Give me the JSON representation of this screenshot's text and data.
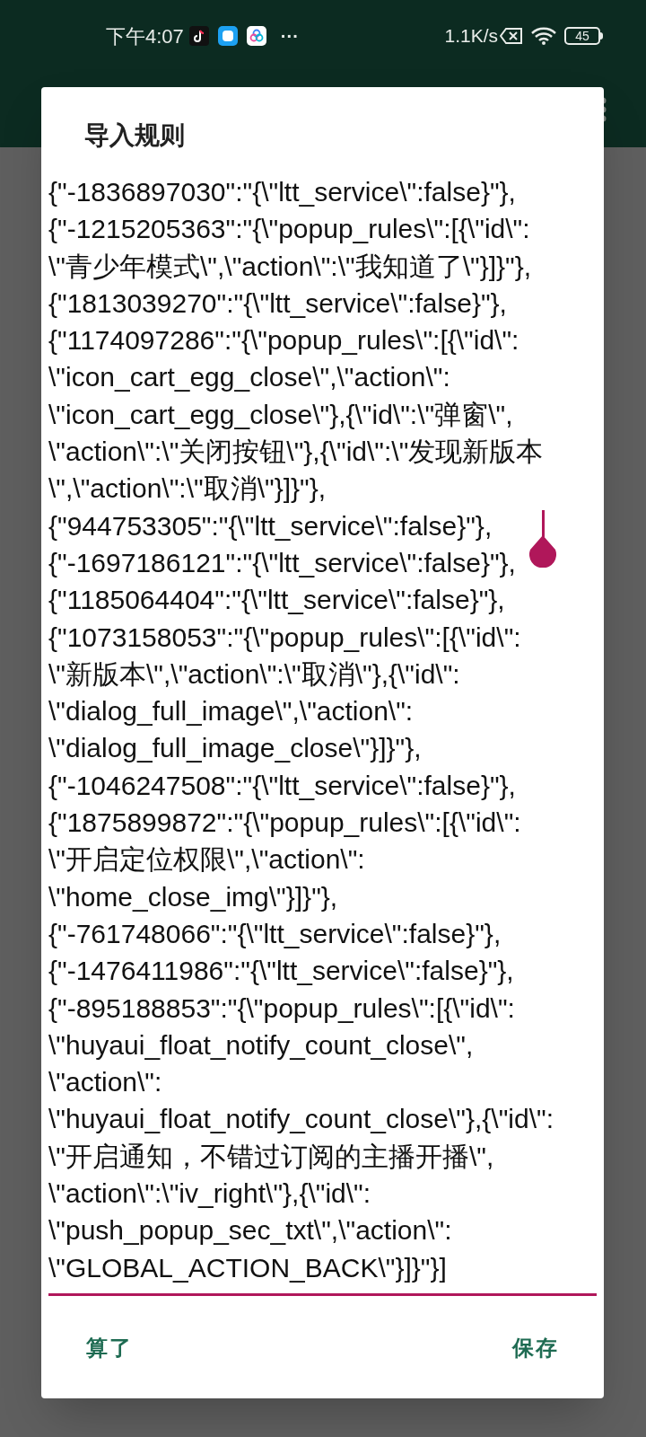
{
  "status_bar": {
    "time": "下午4:07",
    "overflow": "···",
    "speed": "1.1K/s",
    "battery": "45"
  },
  "dialog": {
    "title": "导入规则",
    "field": {
      "focused": true,
      "value": "{\"-1836897030\":\"{\\\"ltt_service\\\":false}\"},\n{\"-1215205363\":\"{\\\"popup_rules\\\":[{\\\"id\\\":\n\\\"青少年模式\\\",\\\"action\\\":\\\"我知道了\\\"}]}\"},\n{\"1813039270\":\"{\\\"ltt_service\\\":false}\"},\n{\"1174097286\":\"{\\\"popup_rules\\\":[{\\\"id\\\":\n\\\"icon_cart_egg_close\\\",\\\"action\\\":\n\\\"icon_cart_egg_close\\\"},{\\\"id\\\":\\\"弹窗\\\",\n\\\"action\\\":\\\"关闭按钮\\\"},{\\\"id\\\":\\\"发现新版本\n\\\",\\\"action\\\":\\\"取消\\\"}]}\"},\n{\"944753305\":\"{\\\"ltt_service\\\":false}\"},\n{\"-1697186121\":\"{\\\"ltt_service\\\":false}\"},\n{\"1185064404\":\"{\\\"ltt_service\\\":false}\"},\n{\"1073158053\":\"{\\\"popup_rules\\\":[{\\\"id\\\":\n\\\"新版本\\\",\\\"action\\\":\\\"取消\\\"},{\\\"id\\\":\n\\\"dialog_full_image\\\",\\\"action\\\":\n\\\"dialog_full_image_close\\\"}]}\"},\n{\"-1046247508\":\"{\\\"ltt_service\\\":false}\"},\n{\"1875899872\":\"{\\\"popup_rules\\\":[{\\\"id\\\":\n\\\"开启定位权限\\\",\\\"action\\\":\n\\\"home_close_img\\\"}]}\"},\n{\"-761748066\":\"{\\\"ltt_service\\\":false}\"},\n{\"-1476411986\":\"{\\\"ltt_service\\\":false}\"},\n{\"-895188853\":\"{\\\"popup_rules\\\":[{\\\"id\\\":\n\\\"huyaui_float_notify_count_close\\\",\n\\\"action\\\":\n\\\"huyaui_float_notify_count_close\\\"},{\\\"id\\\":\n\\\"开启通知，不错过订阅的主播开播\\\",\n\\\"action\\\":\\\"iv_right\\\"},{\\\"id\\\":\n\\\"push_popup_sec_txt\\\",\\\"action\\\":\n\\\"GLOBAL_ACTION_BACK\\\"}]}\"}]"
    },
    "buttons": [
      "算了",
      "保存"
    ]
  }
}
